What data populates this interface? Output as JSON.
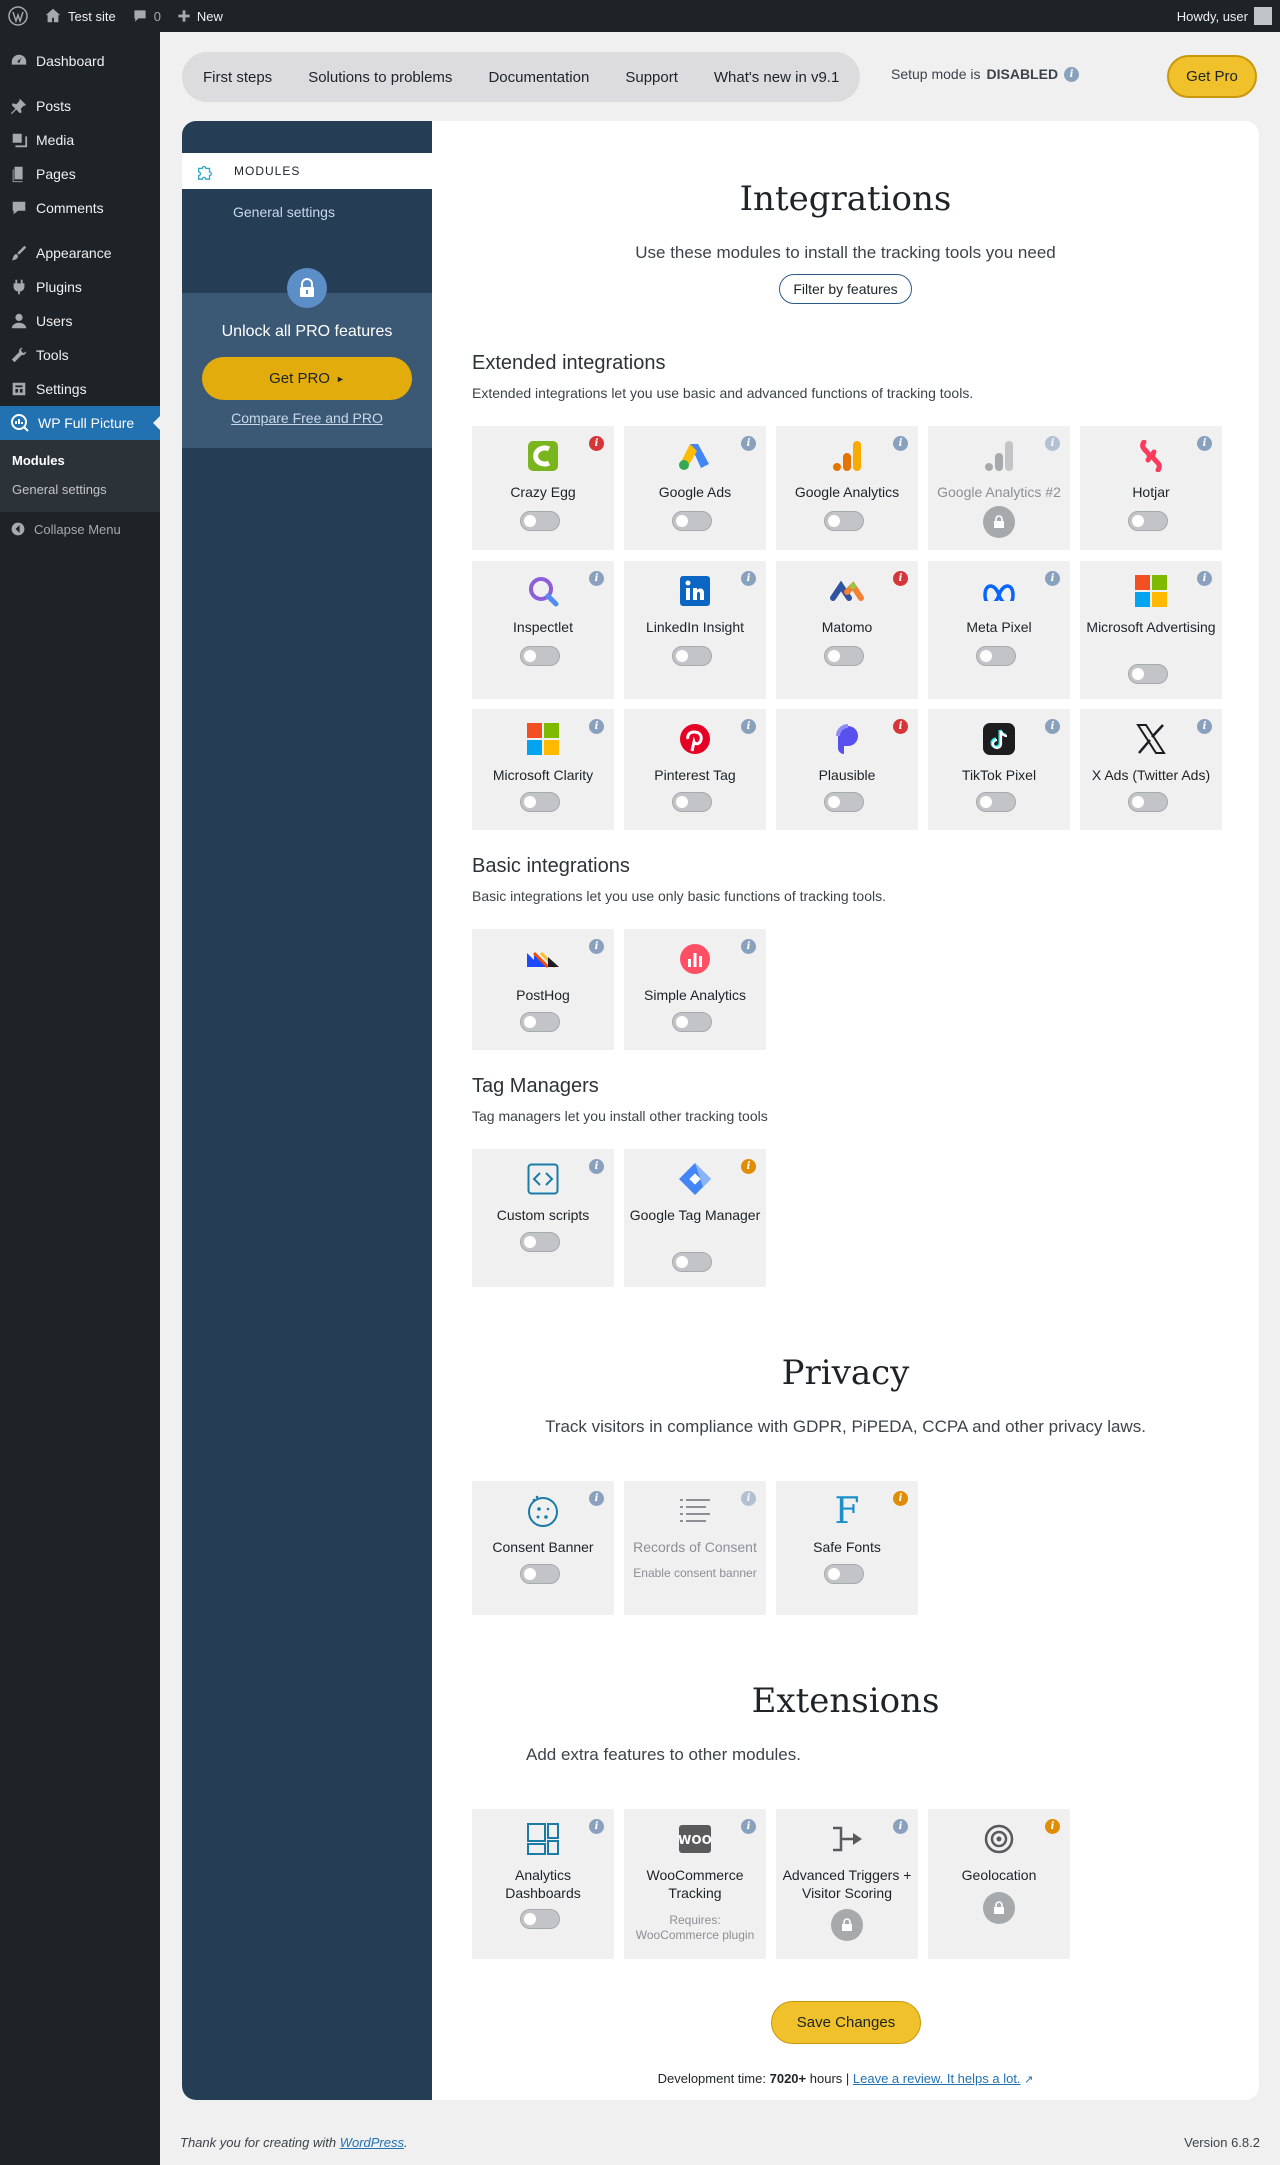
{
  "adminbar": {
    "site": "Test site",
    "comments_count": "0",
    "new_label": "New",
    "howdy": "Howdy, user"
  },
  "menu": {
    "dashboard": "Dashboard",
    "posts": "Posts",
    "media": "Media",
    "pages": "Pages",
    "comments": "Comments",
    "appearance": "Appearance",
    "plugins": "Plugins",
    "users": "Users",
    "tools": "Tools",
    "settings": "Settings",
    "plugin": "WP Full Picture",
    "sub_modules": "Modules",
    "sub_general": "General settings",
    "collapse": "Collapse Menu"
  },
  "topnav": {
    "first_steps": "First steps",
    "solutions": "Solutions to problems",
    "docs": "Documentation",
    "support": "Support",
    "whats_new": "What's new in v9.1"
  },
  "setup": {
    "label": "Setup mode is",
    "value": "DISABLED"
  },
  "get_pro": "Get Pro",
  "side": {
    "modules": "MODULES",
    "general": "General settings",
    "unlock": "Unlock all PRO features",
    "get_pro": "Get PRO",
    "compare": "Compare Free and PRO"
  },
  "integrations": {
    "title": "Integrations",
    "subtitle": "Use these modules to install the tracking tools you need",
    "filter": "Filter by features"
  },
  "extended": {
    "title": "Extended integrations",
    "desc": "Extended integrations let you use basic and advanced functions of tracking tools.",
    "items": [
      "Crazy Egg",
      "Google Ads",
      "Google Analytics",
      "Google Analytics #2",
      "Hotjar",
      "Inspectlet",
      "LinkedIn Insight",
      "Matomo",
      "Meta Pixel",
      "Microsoft Advertising",
      "Microsoft Clarity",
      "Pinterest Tag",
      "Plausible",
      "TikTok Pixel",
      "X Ads (Twitter Ads)"
    ]
  },
  "basic": {
    "title": "Basic integrations",
    "desc": "Basic integrations let you use only basic functions of tracking tools.",
    "items": [
      "PostHog",
      "Simple Analytics"
    ]
  },
  "tagmanagers": {
    "title": "Tag Managers",
    "desc": "Tag managers let you install other tracking tools",
    "items": [
      "Custom scripts",
      "Google Tag Manager"
    ]
  },
  "privacy": {
    "title": "Privacy",
    "subtitle": "Track visitors in compliance with GDPR, PiPEDA, CCPA and other privacy laws.",
    "items": [
      "Consent Banner",
      "Records of Consent",
      "Safe Fonts"
    ],
    "records_note": "Enable consent banner"
  },
  "extensions": {
    "title": "Extensions",
    "subtitle": "Add extra features to other modules.",
    "items": [
      "Analytics Dashboards",
      "WooCommerce Tracking",
      "Advanced Triggers + Visitor Scoring",
      "Geolocation"
    ],
    "woo_note": "Requires: WooCommerce plugin"
  },
  "save": "Save Changes",
  "dev": {
    "label": "Development time:",
    "hours": "7020+",
    "unit": "hours |",
    "review": "Leave a review. It helps a lot."
  },
  "footer": {
    "thanks": "Thank you for creating with",
    "wp": "WordPress",
    "version": "Version 6.8.2"
  },
  "icons": {
    "info": "i"
  },
  "colors": {
    "accent": "#2271b1",
    "sidebar": "#263d56",
    "pro": "#f0c12a"
  }
}
